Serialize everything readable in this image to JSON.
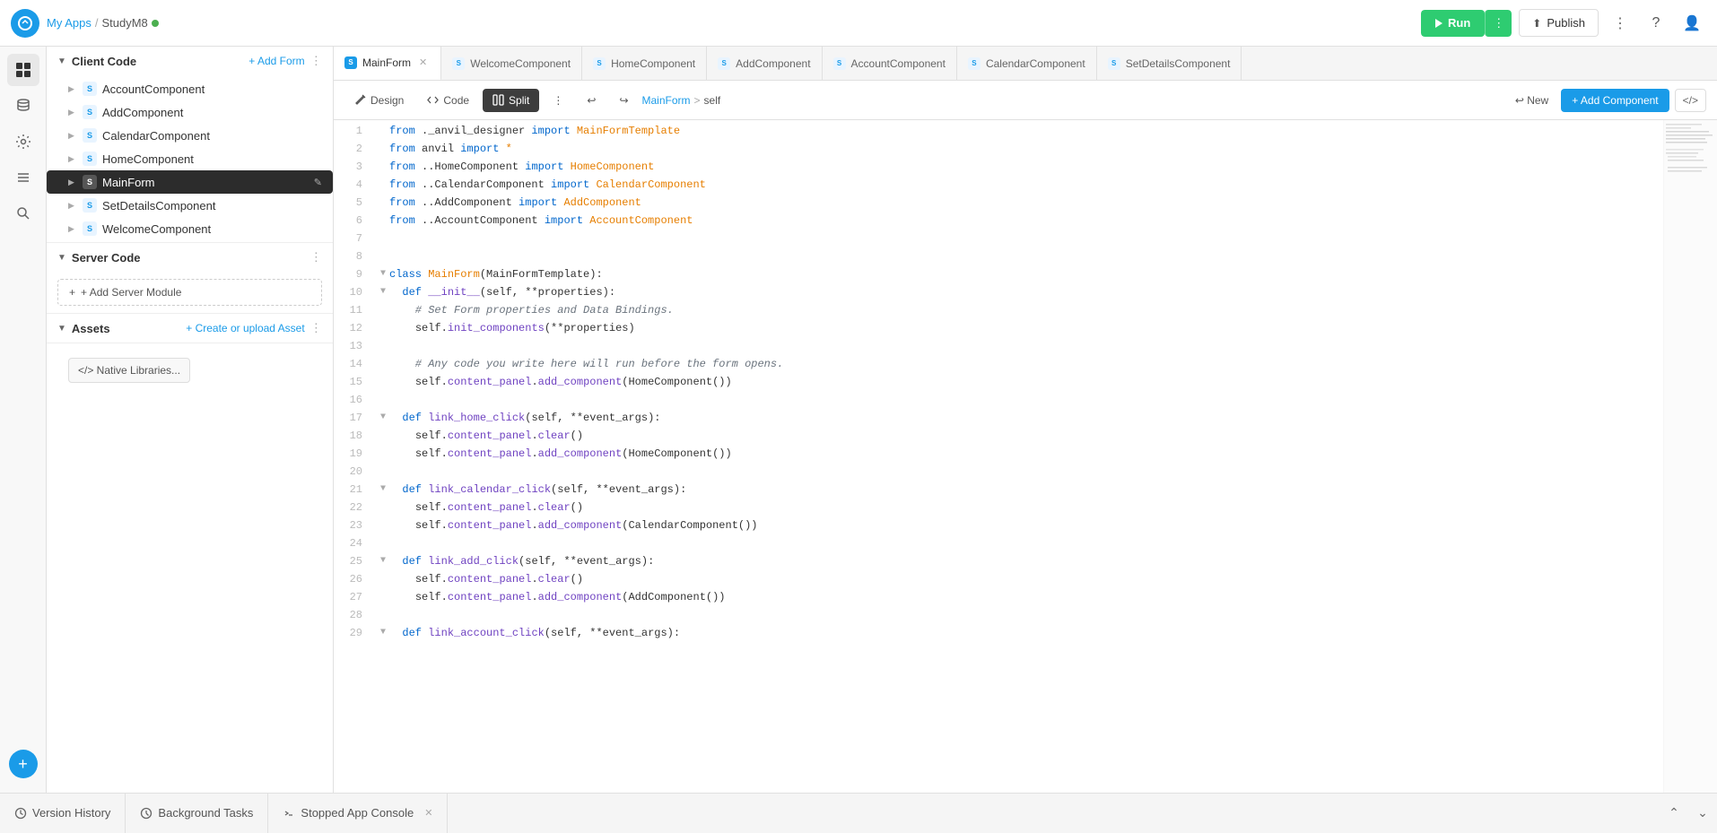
{
  "topbar": {
    "app_link": "My Apps",
    "separator": "/",
    "project_name": "StudyM8",
    "run_label": "Run",
    "publish_label": "Publish"
  },
  "file_panel": {
    "client_code_label": "Client Code",
    "add_form_label": "+ Add Form",
    "server_code_label": "Server Code",
    "assets_label": "Assets",
    "create_asset_label": "+ Create or upload Asset",
    "add_server_module_label": "+ Add Server Module",
    "native_libraries_label": "</> Native Libraries...",
    "files": [
      {
        "name": "AccountComponent",
        "icon": "S"
      },
      {
        "name": "AddComponent",
        "icon": "S"
      },
      {
        "name": "CalendarComponent",
        "icon": "S"
      },
      {
        "name": "HomeComponent",
        "icon": "S"
      },
      {
        "name": "MainForm",
        "icon": "S",
        "active": true
      },
      {
        "name": "SetDetailsComponent",
        "icon": "S"
      },
      {
        "name": "WelcomeComponent",
        "icon": "S"
      }
    ]
  },
  "tabs": [
    {
      "label": "MainForm",
      "icon": "S",
      "active": true,
      "closeable": true
    },
    {
      "label": "WelcomeComponent",
      "icon": "S",
      "closeable": false
    },
    {
      "label": "HomeComponent",
      "icon": "S",
      "closeable": false
    },
    {
      "label": "AddComponent",
      "icon": "S",
      "closeable": false
    },
    {
      "label": "AccountComponent",
      "icon": "S",
      "closeable": false
    },
    {
      "label": "CalendarComponent",
      "icon": "S",
      "closeable": false
    },
    {
      "label": "SetDetailsComponent",
      "icon": "S",
      "closeable": false
    }
  ],
  "toolbar": {
    "design_label": "Design",
    "code_label": "Code",
    "split_label": "Split",
    "breadcrumb_form": "MainForm",
    "breadcrumb_sep": ">",
    "breadcrumb_self": "self",
    "new_label": "↩ New",
    "add_component_label": "+ Add Component"
  },
  "code": {
    "lines": [
      {
        "num": 1,
        "fold": false,
        "text": "from ._anvil_designer import MainFormTemplate"
      },
      {
        "num": 2,
        "fold": false,
        "text": "from anvil import *"
      },
      {
        "num": 3,
        "fold": false,
        "text": "from ..HomeComponent import HomeComponent"
      },
      {
        "num": 4,
        "fold": false,
        "text": "from ..CalendarComponent import CalendarComponent"
      },
      {
        "num": 5,
        "fold": false,
        "text": "from ..AddComponent import AddComponent"
      },
      {
        "num": 6,
        "fold": false,
        "text": "from ..AccountComponent import AccountComponent"
      },
      {
        "num": 7,
        "fold": false,
        "text": ""
      },
      {
        "num": 8,
        "fold": false,
        "text": ""
      },
      {
        "num": 9,
        "fold": true,
        "text": "class MainForm(MainFormTemplate):"
      },
      {
        "num": 10,
        "fold": true,
        "text": "  def __init__(self, **properties):"
      },
      {
        "num": 11,
        "fold": false,
        "text": "    # Set Form properties and Data Bindings."
      },
      {
        "num": 12,
        "fold": false,
        "text": "    self.init_components(**properties)"
      },
      {
        "num": 13,
        "fold": false,
        "text": ""
      },
      {
        "num": 14,
        "fold": false,
        "text": "    # Any code you write here will run before the form opens."
      },
      {
        "num": 15,
        "fold": false,
        "text": "    self.content_panel.add_component(HomeComponent())"
      },
      {
        "num": 16,
        "fold": false,
        "text": ""
      },
      {
        "num": 17,
        "fold": true,
        "text": "  def link_home_click(self, **event_args):"
      },
      {
        "num": 18,
        "fold": false,
        "text": "    self.content_panel.clear()"
      },
      {
        "num": 19,
        "fold": false,
        "text": "    self.content_panel.add_component(HomeComponent())"
      },
      {
        "num": 20,
        "fold": false,
        "text": ""
      },
      {
        "num": 21,
        "fold": true,
        "text": "  def link_calendar_click(self, **event_args):"
      },
      {
        "num": 22,
        "fold": false,
        "text": "    self.content_panel.clear()"
      },
      {
        "num": 23,
        "fold": false,
        "text": "    self.content_panel.add_component(CalendarComponent())"
      },
      {
        "num": 24,
        "fold": false,
        "text": ""
      },
      {
        "num": 25,
        "fold": true,
        "text": "  def link_add_click(self, **event_args):"
      },
      {
        "num": 26,
        "fold": false,
        "text": "    self.content_panel.clear()"
      },
      {
        "num": 27,
        "fold": false,
        "text": "    self.content_panel.add_component(AddComponent())"
      },
      {
        "num": 28,
        "fold": false,
        "text": ""
      },
      {
        "num": 29,
        "fold": true,
        "text": "  def link_account_click(self, **event_args):"
      }
    ]
  },
  "bottom_panel": {
    "version_history_label": "Version History",
    "background_tasks_label": "Background Tasks",
    "stopped_app_console_label": "Stopped App Console"
  }
}
